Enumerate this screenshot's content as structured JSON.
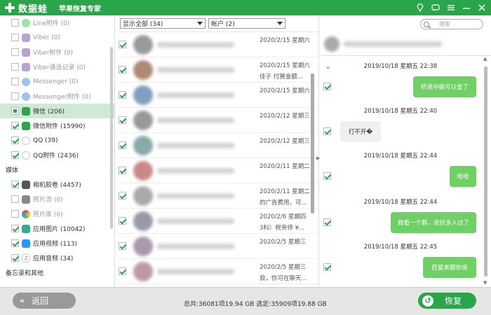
{
  "titlebar": {
    "brand": "数据蛙",
    "subtitle": "苹果恢复专家",
    "icons": [
      "diamond-icon",
      "chat-icon",
      "menu-icon",
      "minimize-icon",
      "close-icon"
    ]
  },
  "sidebar": {
    "items": [
      {
        "label": "Line附件 (0)",
        "icon": "line-icon",
        "checked": false,
        "dim": true
      },
      {
        "label": "Viber (0)",
        "icon": "viber-icon",
        "checked": false,
        "dim": true
      },
      {
        "label": "Viber附件 (0)",
        "icon": "viber-icon",
        "checked": false,
        "dim": true
      },
      {
        "label": "Viber通话记录 (0)",
        "icon": "viber-icon",
        "checked": false,
        "dim": true
      },
      {
        "label": "Messenger (0)",
        "icon": "messenger-icon",
        "checked": false,
        "dim": true
      },
      {
        "label": "Messenger附件 (0)",
        "icon": "messenger-icon",
        "checked": false,
        "dim": true
      },
      {
        "label": "微信 (206)",
        "icon": "wechat-icon",
        "checked": "partial",
        "selected": true
      },
      {
        "label": "微信附件 (15990)",
        "icon": "wechat-icon",
        "checked": true
      },
      {
        "label": "QQ (39)",
        "icon": "qq-icon",
        "checked": true
      },
      {
        "label": "QQ附件 (2436)",
        "icon": "qq-icon",
        "checked": true
      }
    ],
    "section_media": "媒体",
    "media_items": [
      {
        "label": "相机胶卷 (4457)",
        "icon": "camera-icon",
        "checked": true
      },
      {
        "label": "照片流 (0)",
        "icon": "photo-stream-icon",
        "checked": false,
        "dim": true
      },
      {
        "label": "照片库 (0)",
        "icon": "photo-library-icon",
        "checked": false,
        "dim": true
      },
      {
        "label": "应用图片 (10042)",
        "icon": "app-image-icon",
        "checked": true
      },
      {
        "label": "应用视频 (113)",
        "icon": "app-video-icon",
        "checked": true
      },
      {
        "label": "应用音频 (34)",
        "icon": "app-audio-icon",
        "checked": true
      }
    ],
    "section_memo": "备忘录和其他"
  },
  "filters": {
    "show_all": "显示全部 (34)",
    "accounts": "帐户 (2)"
  },
  "conversations": [
    {
      "date": "2020/2/15 星期六",
      "snippet": ""
    },
    {
      "date": "2020/2/15 星期六",
      "snippet": "佳子  付赛金额..."
    },
    {
      "date": "2020/2/15 星期六",
      "snippet": ""
    },
    {
      "date": "2020/2/12 星期三",
      "snippet": ""
    },
    {
      "date": "2020/2/12 星期三",
      "snippet": ""
    },
    {
      "date": "2020/2/11 星期二",
      "snippet": ""
    },
    {
      "date": "2020/2/11 星期二",
      "snippet": "的广告费用，可..."
    },
    {
      "date": "2020/2/6 星期四",
      "snippet": "3科）税务师 ¥..."
    },
    {
      "date": "2020/2/5 星期三",
      "snippet": ""
    },
    {
      "date": "2020/2/5 星期三",
      "snippet": "款，你可在聊天..."
    }
  ],
  "search": {
    "placeholder": "搜索"
  },
  "messages": [
    {
      "time": "2019/10/18 星期五 22:38",
      "text": "听说中级可以查了",
      "side": "right"
    },
    {
      "time": "2019/10/18 星期五 22:40",
      "text": "打不开�",
      "side": "left"
    },
    {
      "time": "2019/10/18 星期五 22:44",
      "text": "哈哈",
      "side": "right"
    },
    {
      "time": "2019/10/18 星期五 22:44",
      "text": "我看一个群，说好多人过了",
      "side": "right"
    },
    {
      "time": "2019/10/18 星期五 22:45",
      "text": "赶紧来跟你说",
      "side": "right"
    }
  ],
  "bottom": {
    "back_label": "返回",
    "status": "总共:36081项19.94 GB 选定:35909项19.88 GB",
    "recover_label": "恢复"
  },
  "colors": {
    "accent": "#2aa54a",
    "selected_row": "#cfe9d6",
    "bubble": "#6fd066"
  }
}
